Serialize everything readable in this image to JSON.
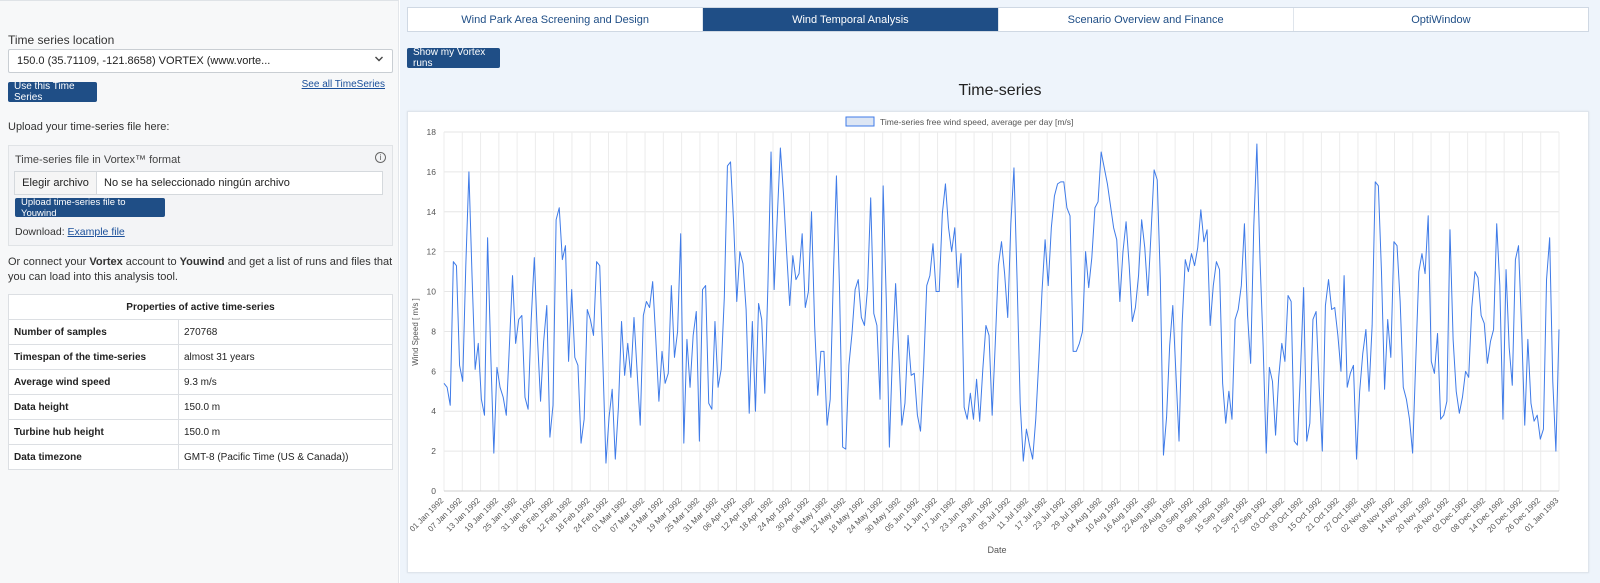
{
  "left_panel": {
    "ts_location_label": "Time series location",
    "ts_select_value": "150.0 (35.71109, -121.8658) VORTEX (www.vorte...",
    "use_button": "Use this Time Series",
    "see_all_link": "See all TimeSeries",
    "upload_hint": "Upload your time-series file here:",
    "upload_box_title": "Time-series file in Vortex™ format",
    "file_button": "Elegir archivo",
    "file_name": "No se ha seleccionado ningún archivo",
    "upload_button": "Upload time-series file to Youwind",
    "download_label": "Download:",
    "download_link": "Example file",
    "connect_text_1": "Or connect your ",
    "connect_bold_1": "Vortex",
    "connect_text_2": " account to ",
    "connect_bold_2": "Youwind",
    "connect_text_3": " and get a list of runs and files that you can load into this analysis tool.",
    "props_title": "Properties of active time-series",
    "props": [
      {
        "key": "Number of samples",
        "value": "270768"
      },
      {
        "key": "Timespan of the time-series",
        "value": "almost 31 years"
      },
      {
        "key": "Average wind speed",
        "value": "9.3 m/s"
      },
      {
        "key": "Data height",
        "value": "150.0 m"
      },
      {
        "key": "Turbine hub height",
        "value": "150.0 m"
      },
      {
        "key": "Data timezone",
        "value": "GMT-8 (Pacific Time (US & Canada))"
      }
    ]
  },
  "tabs": [
    {
      "label": "Wind Park Area Screening and Design",
      "active": false
    },
    {
      "label": "Wind Temporal Analysis",
      "active": true
    },
    {
      "label": "Scenario Overview and Finance",
      "active": false
    },
    {
      "label": "OptiWindow",
      "active": false
    }
  ],
  "vortex_runs_button": "Show my Vortex runs",
  "chart_title": "Time-series",
  "colors": {
    "accent": "#1f4e86",
    "line": "#3f7be8"
  },
  "chart_data": {
    "type": "line",
    "legend": "Time-series free wind speed, average per day [m/s]",
    "xlabel": "Date",
    "ylabel": "Wind Speed [ m/s ]",
    "ylim": [
      0,
      18
    ],
    "yticks": [
      0,
      2,
      4,
      6,
      8,
      10,
      12,
      14,
      16,
      18
    ],
    "xtick_labels": [
      "01 Jan 1992",
      "07 Jan 1992",
      "13 Jan 1992",
      "19 Jan 1992",
      "25 Jan 1992",
      "31 Jan 1992",
      "06 Feb 1992",
      "12 Feb 1992",
      "18 Feb 1992",
      "24 Feb 1992",
      "01 Mar 1992",
      "07 Mar 1992",
      "13 Mar 1992",
      "19 Mar 1992",
      "25 Mar 1992",
      "31 Mar 1992",
      "06 Apr 1992",
      "12 Apr 1992",
      "18 Apr 1992",
      "24 Apr 1992",
      "30 Apr 1992",
      "06 May 1992",
      "12 May 1992",
      "18 May 1992",
      "24 May 1992",
      "30 May 1992",
      "05 Jun 1992",
      "11 Jun 1992",
      "17 Jun 1992",
      "23 Jun 1992",
      "29 Jun 1992",
      "05 Jul 1992",
      "11 Jul 1992",
      "17 Jul 1992",
      "23 Jul 1992",
      "29 Jul 1992",
      "04 Aug 1992",
      "10 Aug 1992",
      "16 Aug 1992",
      "22 Aug 1992",
      "28 Aug 1992",
      "03 Sep 1992",
      "09 Sep 1992",
      "15 Sep 1992",
      "21 Sep 1992",
      "27 Sep 1992",
      "03 Oct 1992",
      "09 Oct 1992",
      "15 Oct 1992",
      "21 Oct 1992",
      "27 Oct 1992",
      "02 Nov 1992",
      "08 Nov 1992",
      "14 Nov 1992",
      "20 Nov 1992",
      "26 Nov 1992",
      "02 Dec 1992",
      "08 Dec 1992",
      "14 Dec 1992",
      "20 Dec 1992",
      "26 Dec 1992",
      "01 Jan 1993"
    ],
    "values": [
      5.4,
      5.2,
      4.3,
      11.5,
      11.3,
      6.3,
      5.5,
      11.3,
      16.0,
      10.8,
      6.1,
      7.4,
      4.6,
      3.8,
      12.7,
      6.9,
      1.9,
      6.2,
      5.2,
      4.7,
      3.8,
      7.3,
      10.8,
      7.4,
      8.6,
      8.8,
      4.7,
      4.1,
      8.6,
      11.7,
      7.7,
      4.5,
      7.5,
      9.3,
      2.7,
      4.3,
      13.6,
      14.2,
      11.6,
      12.3,
      6.5,
      10.1,
      6.7,
      6.3,
      2.4,
      3.6,
      9.1,
      8.6,
      7.8,
      11.5,
      11.3,
      6.5,
      1.4,
      3.7,
      5.1,
      1.6,
      4.2,
      8.5,
      5.8,
      7.4,
      5.7,
      8.7,
      6.0,
      3.3,
      8.8,
      9.5,
      9.2,
      10.5,
      7.6,
      4.5,
      7.0,
      5.4,
      5.9,
      10.3,
      6.7,
      8.0,
      12.9,
      2.4,
      7.6,
      5.2,
      7.8,
      9.0,
      2.5,
      10.1,
      10.3,
      4.4,
      4.1,
      8.5,
      5.2,
      6.1,
      9.7,
      16.3,
      16.5,
      13.4,
      9.5,
      12.0,
      11.4,
      9.1,
      3.9,
      8.5,
      4.0,
      9.4,
      8.6,
      4.9,
      10.3,
      17.0,
      10.1,
      13.7,
      17.2,
      14.9,
      12.0,
      9.3,
      11.8,
      10.6,
      10.9,
      12.9,
      9.2,
      10.0,
      14.0,
      8.3,
      4.8,
      7.0,
      7.0,
      3.3,
      4.6,
      10.7,
      15.8,
      10.1,
      2.2,
      2.1,
      6.3,
      7.9,
      10.1,
      10.6,
      8.7,
      8.3,
      10.2,
      14.7,
      8.9,
      8.3,
      4.6,
      15.3,
      9.6,
      2.2,
      6.9,
      10.4,
      7.0,
      3.3,
      4.4,
      7.8,
      5.8,
      5.9,
      3.8,
      3.0,
      6.2,
      10.3,
      10.8,
      12.4,
      10.0,
      10.0,
      13.9,
      15.4,
      13.2,
      12.0,
      13.2,
      10.2,
      11.9,
      4.2,
      3.6,
      4.9,
      3.6,
      5.6,
      3.5,
      6.1,
      8.3,
      7.8,
      3.8,
      7.4,
      11.3,
      12.5,
      10.9,
      8.7,
      13.4,
      16.2,
      10.6,
      4.4,
      1.5,
      3.1,
      2.3,
      1.6,
      3.6,
      6.6,
      10.0,
      12.6,
      10.3,
      13.2,
      14.8,
      15.4,
      15.5,
      15.5,
      14.2,
      13.8,
      7.0,
      7.0,
      7.4,
      8.0,
      12.0,
      10.2,
      11.7,
      14.2,
      14.5,
      17.0,
      16.2,
      15.4,
      14.3,
      13.2,
      12.6,
      9.5,
      12.0,
      13.5,
      11.3,
      8.5,
      9.2,
      10.8,
      13.6,
      12.2,
      9.8,
      12.9,
      16.1,
      15.6,
      10.6,
      1.8,
      3.7,
      7.3,
      9.3,
      5.9,
      2.5,
      8.4,
      11.6,
      11.0,
      11.9,
      11.3,
      12.2,
      14.1,
      12.5,
      13.1,
      8.3,
      10.3,
      11.5,
      11.1,
      5.4,
      3.4,
      5.0,
      3.6,
      8.6,
      9.1,
      10.3,
      13.4,
      8.8,
      6.4,
      13.3,
      17.4,
      11.6,
      7.3,
      1.9,
      6.2,
      5.5,
      2.8,
      5.7,
      7.4,
      6.5,
      9.8,
      9.5,
      2.5,
      2.3,
      6.0,
      10.2,
      2.5,
      3.4,
      8.6,
      9.0,
      5.2,
      2.0,
      9.3,
      10.6,
      9.1,
      9.2,
      7.8,
      6.0,
      10.8,
      5.2,
      5.9,
      6.3,
      1.6,
      5.0,
      6.9,
      8.1,
      5.0,
      8.3,
      15.5,
      15.3,
      11.0,
      5.1,
      8.6,
      6.7,
      12.5,
      12.3,
      9.5,
      5.2,
      4.6,
      3.6,
      1.9,
      6.5,
      11.0,
      11.9,
      10.9,
      13.8,
      6.5,
      5.9,
      7.9,
      3.6,
      3.8,
      4.5,
      13.1,
      7.6,
      5.0,
      3.9,
      4.7,
      6.0,
      5.7,
      9.2,
      11.0,
      10.7,
      8.8,
      8.4,
      6.4,
      7.5,
      8.1,
      13.4,
      10.3,
      3.6,
      11.1,
      7.2,
      5.3,
      11.6,
      12.3,
      8.1,
      3.3,
      7.6,
      4.4,
      3.5,
      3.8,
      2.6,
      3.1,
      10.6,
      12.7,
      5.5,
      2.0,
      8.1
    ]
  }
}
